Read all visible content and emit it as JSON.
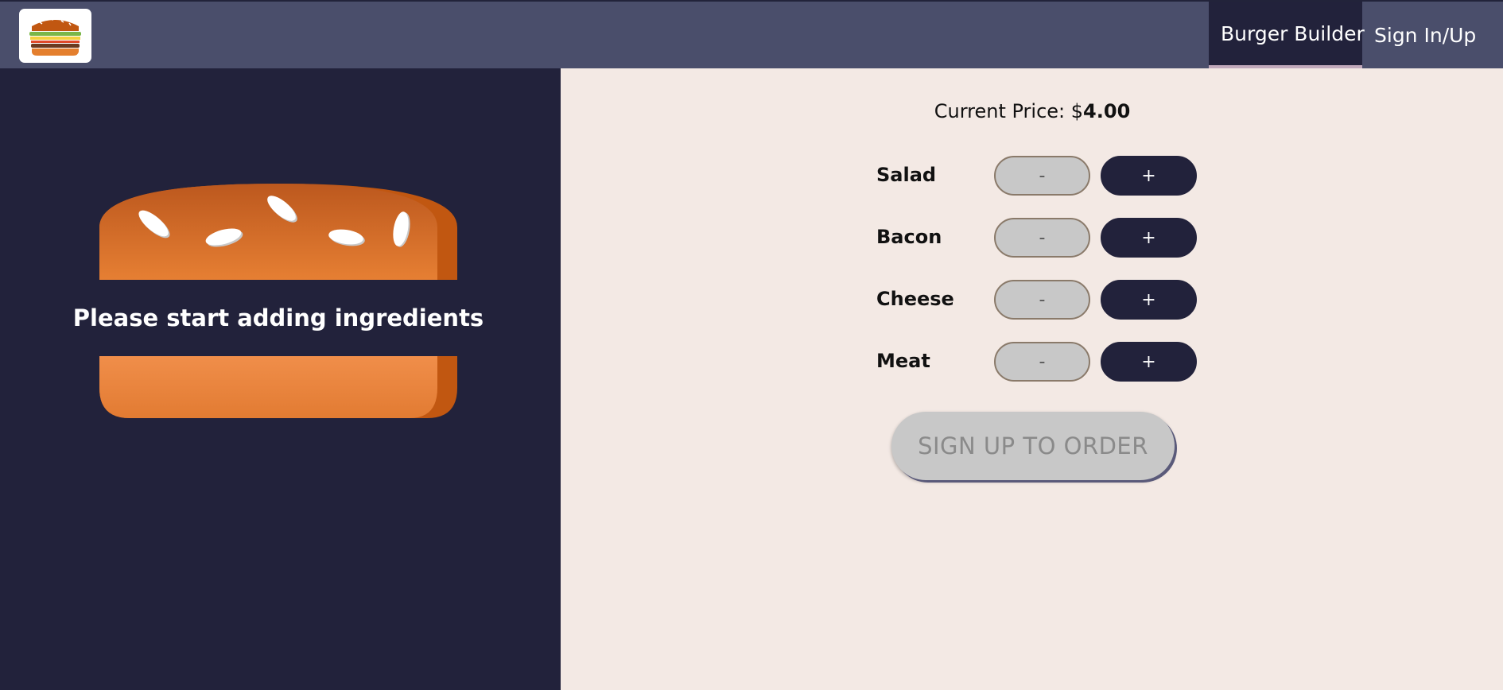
{
  "app": {
    "logo_icon": "burger-logo-icon"
  },
  "nav": {
    "items": [
      {
        "label": "Burger Builder",
        "active": true
      },
      {
        "label": "Sign In/Up",
        "active": false
      }
    ]
  },
  "burger": {
    "empty_message": "Please start adding ingredients",
    "colors": {
      "bun": "#e47f2e",
      "bun_shadow": "#c15711",
      "seed": "#ffffff",
      "background": "#22223b"
    }
  },
  "controls": {
    "price_label": "Current Price: $",
    "price_value": "4.00",
    "ingredients": [
      {
        "label": "Salad",
        "less_label": "-",
        "more_label": "+"
      },
      {
        "label": "Bacon",
        "less_label": "-",
        "more_label": "+"
      },
      {
        "label": "Cheese",
        "less_label": "-",
        "more_label": "+"
      },
      {
        "label": "Meat",
        "less_label": "-",
        "more_label": "+"
      }
    ],
    "order_button_label": "SIGN UP TO ORDER"
  }
}
